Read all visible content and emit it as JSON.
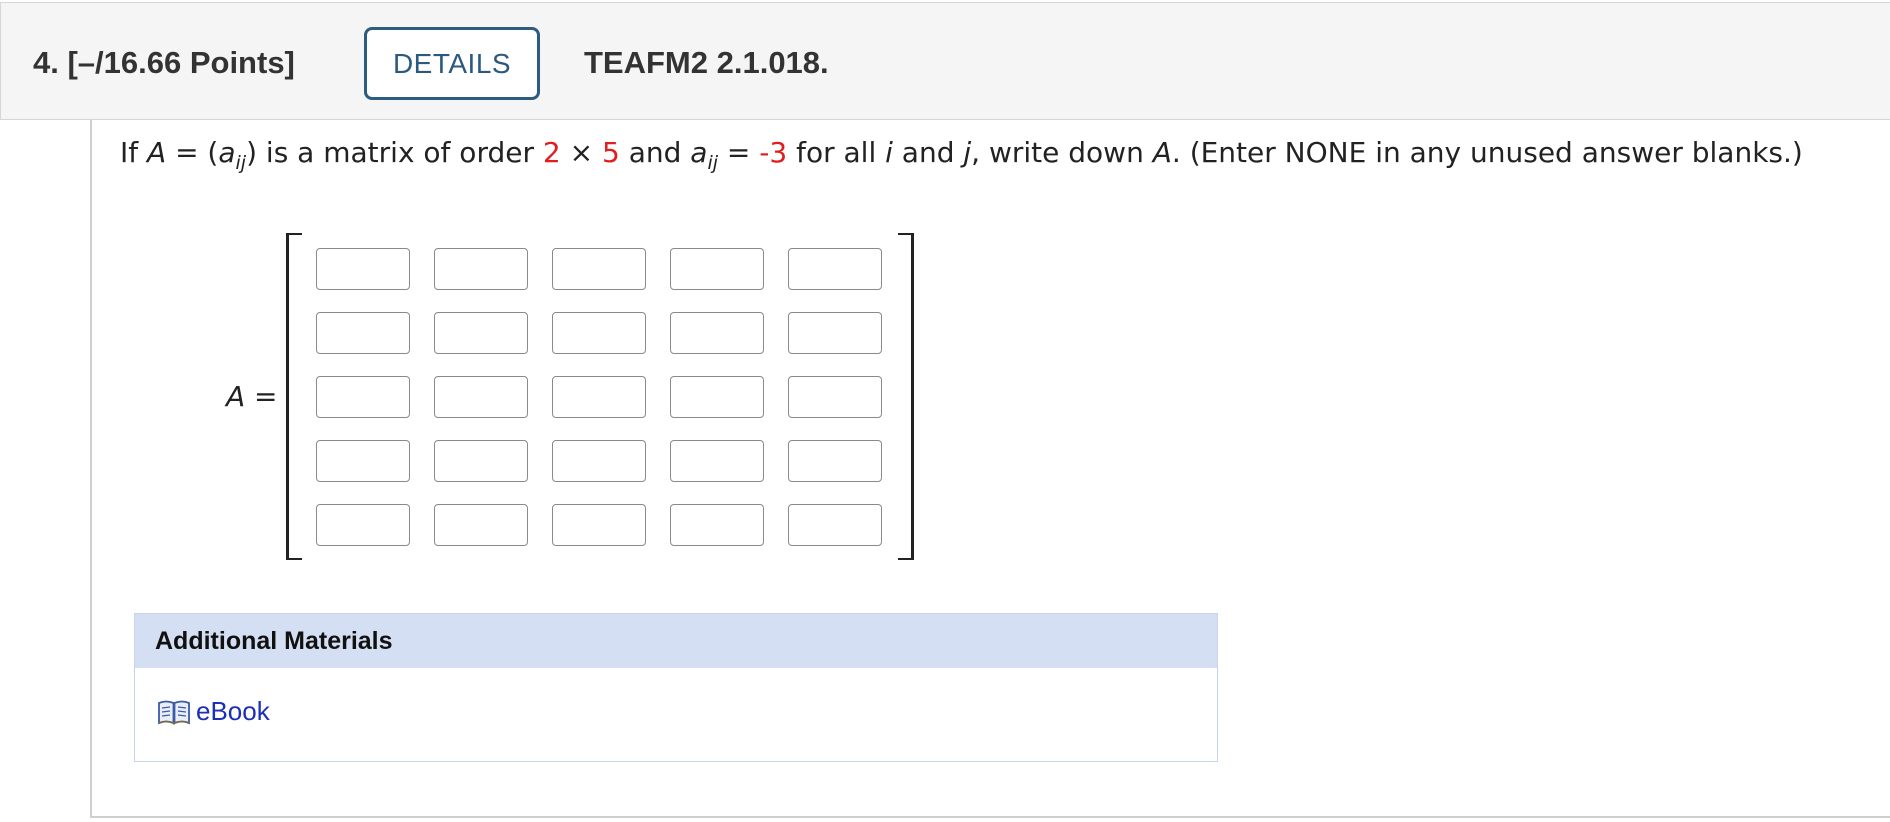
{
  "header": {
    "question_title": "4.  [–/16.66 Points]",
    "details_label": "DETAILS",
    "question_code": "TEAFM2 2.1.018."
  },
  "prompt": {
    "if": "If ",
    "A1": "A",
    "eq1": " = (",
    "a1": "a",
    "ij1": "ij",
    "mid1": ") is a matrix of order ",
    "rows": "2",
    "times": " × ",
    "cols": "5",
    "and1": " and ",
    "a2": "a",
    "ij2": "ij",
    "eq2": " = ",
    "value": "-3",
    "for_all": " for all ",
    "i": "i",
    "and2": " and ",
    "j": "j",
    "write": ", write down ",
    "A2": "A",
    "rest": ". (Enter NONE in any unused answer blanks.)"
  },
  "matrix": {
    "label_var": "A",
    "label_eq": " =",
    "rows": 5,
    "cols": 5,
    "values": [
      "",
      "",
      "",
      "",
      "",
      "",
      "",
      "",
      "",
      "",
      "",
      "",
      "",
      "",
      "",
      "",
      "",
      "",
      "",
      "",
      "",
      "",
      "",
      "",
      ""
    ]
  },
  "materials": {
    "heading": "Additional Materials",
    "link_label": "eBook",
    "link_icon": "book-icon"
  },
  "colors": {
    "accent_red": "#e11d1d",
    "details_border": "#2e5c80",
    "materials_header_bg": "#d5dff3",
    "link_blue": "#1b2fb8"
  }
}
